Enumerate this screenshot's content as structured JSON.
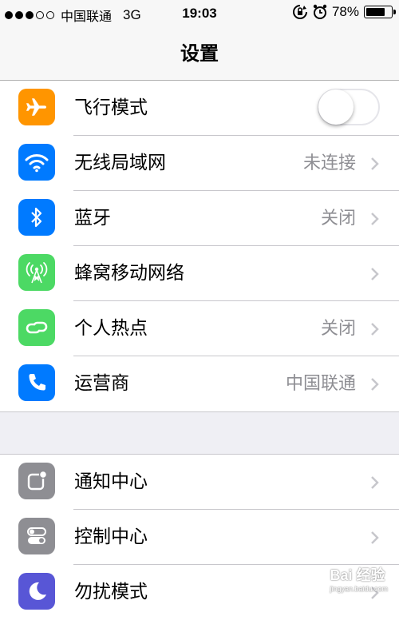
{
  "status_bar": {
    "carrier": "中国联通",
    "network": "3G",
    "time": "19:03",
    "battery": "78%",
    "battery_level": 0.78,
    "signal_bars": 3,
    "signal_total": 5
  },
  "nav": {
    "title": "设置"
  },
  "group1": [
    {
      "label": "飞行模式",
      "icon": "airplane-icon",
      "icon_color": "#ff9500",
      "type": "toggle",
      "toggle_on": false
    },
    {
      "label": "无线局域网",
      "value": "未连接",
      "icon": "wifi-icon",
      "icon_color": "#007aff"
    },
    {
      "label": "蓝牙",
      "value": "关闭",
      "icon": "bluetooth-icon",
      "icon_color": "#007aff"
    },
    {
      "label": "蜂窝移动网络",
      "value": "",
      "icon": "cellular-icon",
      "icon_color": "#4cd964"
    },
    {
      "label": "个人热点",
      "value": "关闭",
      "icon": "hotspot-icon",
      "icon_color": "#4cd964"
    },
    {
      "label": "运营商",
      "value": "中国联通",
      "icon": "phone-icon",
      "icon_color": "#007aff"
    }
  ],
  "group2": [
    {
      "label": "通知中心",
      "icon": "notification-icon",
      "icon_color": "#8e8e93"
    },
    {
      "label": "控制中心",
      "icon": "control-center-icon",
      "icon_color": "#8e8e93"
    },
    {
      "label": "勿扰模式",
      "icon": "moon-icon",
      "icon_color": "#5856d6"
    }
  ],
  "watermark": {
    "main": "Bai 经验",
    "sub": "jingyan.baidu.com"
  }
}
